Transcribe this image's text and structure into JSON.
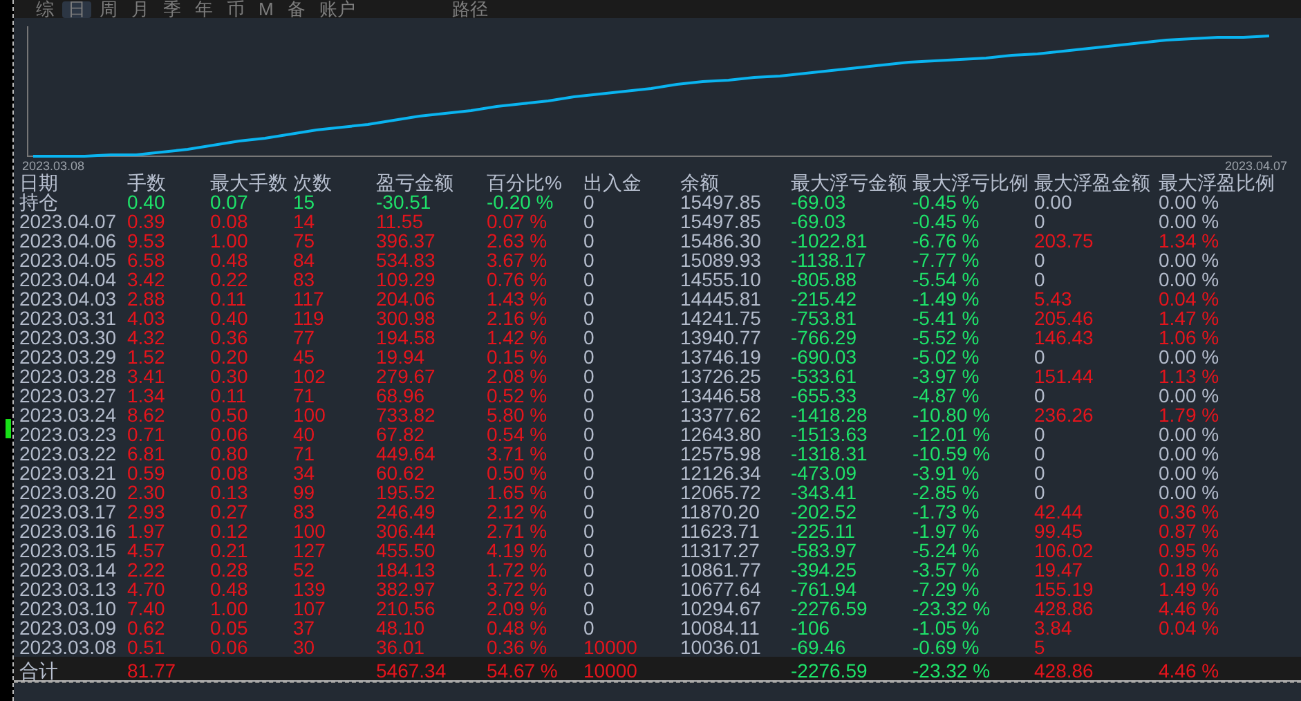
{
  "tabs": [
    {
      "label": "综",
      "selected": false
    },
    {
      "label": "日",
      "selected": true
    },
    {
      "label": "周",
      "selected": false
    },
    {
      "label": "月",
      "selected": false
    },
    {
      "label": "季",
      "selected": false
    },
    {
      "label": "年",
      "selected": false
    },
    {
      "label": "币",
      "selected": false
    },
    {
      "label": "M",
      "selected": false
    },
    {
      "label": "备",
      "selected": false
    },
    {
      "label": "账户",
      "selected": false
    },
    {
      "label": "路径",
      "selected": false
    }
  ],
  "chart": {
    "start_label": "2023.03.08",
    "end_label": "2023.04.07"
  },
  "table": {
    "columns": [
      "日期",
      "手数",
      "最大手数",
      "次数",
      "盈亏金额",
      "百分比%",
      "出入金",
      "余额",
      "最大浮亏金额",
      "最大浮亏比例",
      "最大浮盈金额",
      "最大浮盈比例"
    ],
    "rows": [
      [
        {
          "text": "持仓",
          "color": "#b8c0d0"
        },
        {
          "text": "0.40",
          "color": "#1ee36a"
        },
        {
          "text": "0.07",
          "color": "#1ee36a"
        },
        {
          "text": "15",
          "color": "#1ee36a"
        },
        {
          "text": "-30.51",
          "color": "#1ee36a"
        },
        {
          "text": "-0.20 %",
          "color": "#1ee36a"
        },
        {
          "text": "0",
          "color": "#b4bccc"
        },
        {
          "text": "15497.85",
          "color": "#b4bccc"
        },
        {
          "text": "-69.03",
          "color": "#1ee36a"
        },
        {
          "text": "-0.45 %",
          "color": "#1ee36a"
        },
        {
          "text": "0.00",
          "color": "#b4bccc"
        },
        {
          "text": "0.00 %",
          "color": "#b4bccc"
        }
      ],
      [
        {
          "text": "2023.04.07",
          "color": "#b4bccc"
        },
        {
          "text": "0.39",
          "color": "#e5141c"
        },
        {
          "text": "0.08",
          "color": "#e5141c"
        },
        {
          "text": "14",
          "color": "#e5141c"
        },
        {
          "text": "11.55",
          "color": "#e5141c"
        },
        {
          "text": "0.07 %",
          "color": "#e5141c"
        },
        {
          "text": "0",
          "color": "#b4bccc"
        },
        {
          "text": "15497.85",
          "color": "#b4bccc"
        },
        {
          "text": "-69.03",
          "color": "#1ee36a"
        },
        {
          "text": "-0.45 %",
          "color": "#1ee36a"
        },
        {
          "text": "0",
          "color": "#b4bccc"
        },
        {
          "text": "0.00 %",
          "color": "#b4bccc"
        }
      ],
      [
        {
          "text": "2023.04.06",
          "color": "#b4bccc"
        },
        {
          "text": "9.53",
          "color": "#e5141c"
        },
        {
          "text": "1.00",
          "color": "#e5141c"
        },
        {
          "text": "75",
          "color": "#e5141c"
        },
        {
          "text": "396.37",
          "color": "#e5141c"
        },
        {
          "text": "2.63 %",
          "color": "#e5141c"
        },
        {
          "text": "0",
          "color": "#b4bccc"
        },
        {
          "text": "15486.30",
          "color": "#b4bccc"
        },
        {
          "text": "-1022.81",
          "color": "#1ee36a"
        },
        {
          "text": "-6.76 %",
          "color": "#1ee36a"
        },
        {
          "text": "203.75",
          "color": "#e5141c"
        },
        {
          "text": "1.34 %",
          "color": "#e5141c"
        }
      ],
      [
        {
          "text": "2023.04.05",
          "color": "#b4bccc"
        },
        {
          "text": "6.58",
          "color": "#e5141c"
        },
        {
          "text": "0.48",
          "color": "#e5141c"
        },
        {
          "text": "84",
          "color": "#e5141c"
        },
        {
          "text": "534.83",
          "color": "#e5141c"
        },
        {
          "text": "3.67 %",
          "color": "#e5141c"
        },
        {
          "text": "0",
          "color": "#b4bccc"
        },
        {
          "text": "15089.93",
          "color": "#b4bccc"
        },
        {
          "text": "-1138.17",
          "color": "#1ee36a"
        },
        {
          "text": "-7.77 %",
          "color": "#1ee36a"
        },
        {
          "text": "0",
          "color": "#b4bccc"
        },
        {
          "text": "0.00 %",
          "color": "#b4bccc"
        }
      ],
      [
        {
          "text": "2023.04.04",
          "color": "#b4bccc"
        },
        {
          "text": "3.42",
          "color": "#e5141c"
        },
        {
          "text": "0.22",
          "color": "#e5141c"
        },
        {
          "text": "83",
          "color": "#e5141c"
        },
        {
          "text": "109.29",
          "color": "#e5141c"
        },
        {
          "text": "0.76 %",
          "color": "#e5141c"
        },
        {
          "text": "0",
          "color": "#b4bccc"
        },
        {
          "text": "14555.10",
          "color": "#b4bccc"
        },
        {
          "text": "-805.88",
          "color": "#1ee36a"
        },
        {
          "text": "-5.54 %",
          "color": "#1ee36a"
        },
        {
          "text": "0",
          "color": "#b4bccc"
        },
        {
          "text": "0.00 %",
          "color": "#b4bccc"
        }
      ],
      [
        {
          "text": "2023.04.03",
          "color": "#b4bccc"
        },
        {
          "text": "2.88",
          "color": "#e5141c"
        },
        {
          "text": "0.11",
          "color": "#e5141c"
        },
        {
          "text": "117",
          "color": "#e5141c"
        },
        {
          "text": "204.06",
          "color": "#e5141c"
        },
        {
          "text": "1.43 %",
          "color": "#e5141c"
        },
        {
          "text": "0",
          "color": "#b4bccc"
        },
        {
          "text": "14445.81",
          "color": "#b4bccc"
        },
        {
          "text": "-215.42",
          "color": "#1ee36a"
        },
        {
          "text": "-1.49 %",
          "color": "#1ee36a"
        },
        {
          "text": "5.43",
          "color": "#e5141c"
        },
        {
          "text": "0.04 %",
          "color": "#e5141c"
        }
      ],
      [
        {
          "text": "2023.03.31",
          "color": "#b4bccc"
        },
        {
          "text": "4.03",
          "color": "#e5141c"
        },
        {
          "text": "0.40",
          "color": "#e5141c"
        },
        {
          "text": "119",
          "color": "#e5141c"
        },
        {
          "text": "300.98",
          "color": "#e5141c"
        },
        {
          "text": "2.16 %",
          "color": "#e5141c"
        },
        {
          "text": "0",
          "color": "#b4bccc"
        },
        {
          "text": "14241.75",
          "color": "#b4bccc"
        },
        {
          "text": "-753.81",
          "color": "#1ee36a"
        },
        {
          "text": "-5.41 %",
          "color": "#1ee36a"
        },
        {
          "text": "205.46",
          "color": "#e5141c"
        },
        {
          "text": "1.47 %",
          "color": "#e5141c"
        }
      ],
      [
        {
          "text": "2023.03.30",
          "color": "#b4bccc"
        },
        {
          "text": "4.32",
          "color": "#e5141c"
        },
        {
          "text": "0.36",
          "color": "#e5141c"
        },
        {
          "text": "77",
          "color": "#e5141c"
        },
        {
          "text": "194.58",
          "color": "#e5141c"
        },
        {
          "text": "1.42 %",
          "color": "#e5141c"
        },
        {
          "text": "0",
          "color": "#b4bccc"
        },
        {
          "text": "13940.77",
          "color": "#b4bccc"
        },
        {
          "text": "-766.29",
          "color": "#1ee36a"
        },
        {
          "text": "-5.52 %",
          "color": "#1ee36a"
        },
        {
          "text": "146.43",
          "color": "#e5141c"
        },
        {
          "text": "1.06 %",
          "color": "#e5141c"
        }
      ],
      [
        {
          "text": "2023.03.29",
          "color": "#b4bccc"
        },
        {
          "text": "1.52",
          "color": "#e5141c"
        },
        {
          "text": "0.20",
          "color": "#e5141c"
        },
        {
          "text": "45",
          "color": "#e5141c"
        },
        {
          "text": "19.94",
          "color": "#e5141c"
        },
        {
          "text": "0.15 %",
          "color": "#e5141c"
        },
        {
          "text": "0",
          "color": "#b4bccc"
        },
        {
          "text": "13746.19",
          "color": "#b4bccc"
        },
        {
          "text": "-690.03",
          "color": "#1ee36a"
        },
        {
          "text": "-5.02 %",
          "color": "#1ee36a"
        },
        {
          "text": "0",
          "color": "#b4bccc"
        },
        {
          "text": "0.00 %",
          "color": "#b4bccc"
        }
      ],
      [
        {
          "text": "2023.03.28",
          "color": "#b4bccc"
        },
        {
          "text": "3.41",
          "color": "#e5141c"
        },
        {
          "text": "0.30",
          "color": "#e5141c"
        },
        {
          "text": "102",
          "color": "#e5141c"
        },
        {
          "text": "279.67",
          "color": "#e5141c"
        },
        {
          "text": "2.08 %",
          "color": "#e5141c"
        },
        {
          "text": "0",
          "color": "#b4bccc"
        },
        {
          "text": "13726.25",
          "color": "#b4bccc"
        },
        {
          "text": "-533.61",
          "color": "#1ee36a"
        },
        {
          "text": "-3.97 %",
          "color": "#1ee36a"
        },
        {
          "text": "151.44",
          "color": "#e5141c"
        },
        {
          "text": "1.13 %",
          "color": "#e5141c"
        }
      ],
      [
        {
          "text": "2023.03.27",
          "color": "#b4bccc"
        },
        {
          "text": "1.34",
          "color": "#e5141c"
        },
        {
          "text": "0.11",
          "color": "#e5141c"
        },
        {
          "text": "71",
          "color": "#e5141c"
        },
        {
          "text": "68.96",
          "color": "#e5141c"
        },
        {
          "text": "0.52 %",
          "color": "#e5141c"
        },
        {
          "text": "0",
          "color": "#b4bccc"
        },
        {
          "text": "13446.58",
          "color": "#b4bccc"
        },
        {
          "text": "-655.33",
          "color": "#1ee36a"
        },
        {
          "text": "-4.87 %",
          "color": "#1ee36a"
        },
        {
          "text": "0",
          "color": "#b4bccc"
        },
        {
          "text": "0.00 %",
          "color": "#b4bccc"
        }
      ],
      [
        {
          "text": "2023.03.24",
          "color": "#b4bccc"
        },
        {
          "text": "8.62",
          "color": "#e5141c"
        },
        {
          "text": "0.50",
          "color": "#e5141c"
        },
        {
          "text": "100",
          "color": "#e5141c"
        },
        {
          "text": "733.82",
          "color": "#e5141c"
        },
        {
          "text": "5.80 %",
          "color": "#e5141c"
        },
        {
          "text": "0",
          "color": "#b4bccc"
        },
        {
          "text": "13377.62",
          "color": "#b4bccc"
        },
        {
          "text": "-1418.28",
          "color": "#1ee36a"
        },
        {
          "text": "-10.80 %",
          "color": "#1ee36a"
        },
        {
          "text": "236.26",
          "color": "#e5141c"
        },
        {
          "text": "1.79 %",
          "color": "#e5141c"
        }
      ],
      [
        {
          "text": "2023.03.23",
          "color": "#b4bccc"
        },
        {
          "text": "0.71",
          "color": "#e5141c"
        },
        {
          "text": "0.06",
          "color": "#e5141c"
        },
        {
          "text": "40",
          "color": "#e5141c"
        },
        {
          "text": "67.82",
          "color": "#e5141c"
        },
        {
          "text": "0.54 %",
          "color": "#e5141c"
        },
        {
          "text": "0",
          "color": "#b4bccc"
        },
        {
          "text": "12643.80",
          "color": "#b4bccc"
        },
        {
          "text": "-1513.63",
          "color": "#1ee36a"
        },
        {
          "text": "-12.01 %",
          "color": "#1ee36a"
        },
        {
          "text": "0",
          "color": "#b4bccc"
        },
        {
          "text": "0.00 %",
          "color": "#b4bccc"
        }
      ],
      [
        {
          "text": "2023.03.22",
          "color": "#b4bccc"
        },
        {
          "text": "6.81",
          "color": "#e5141c"
        },
        {
          "text": "0.80",
          "color": "#e5141c"
        },
        {
          "text": "71",
          "color": "#e5141c"
        },
        {
          "text": "449.64",
          "color": "#e5141c"
        },
        {
          "text": "3.71 %",
          "color": "#e5141c"
        },
        {
          "text": "0",
          "color": "#b4bccc"
        },
        {
          "text": "12575.98",
          "color": "#b4bccc"
        },
        {
          "text": "-1318.31",
          "color": "#1ee36a"
        },
        {
          "text": "-10.59 %",
          "color": "#1ee36a"
        },
        {
          "text": "0",
          "color": "#b4bccc"
        },
        {
          "text": "0.00 %",
          "color": "#b4bccc"
        }
      ],
      [
        {
          "text": "2023.03.21",
          "color": "#b4bccc"
        },
        {
          "text": "0.59",
          "color": "#e5141c"
        },
        {
          "text": "0.08",
          "color": "#e5141c"
        },
        {
          "text": "34",
          "color": "#e5141c"
        },
        {
          "text": "60.62",
          "color": "#e5141c"
        },
        {
          "text": "0.50 %",
          "color": "#e5141c"
        },
        {
          "text": "0",
          "color": "#b4bccc"
        },
        {
          "text": "12126.34",
          "color": "#b4bccc"
        },
        {
          "text": "-473.09",
          "color": "#1ee36a"
        },
        {
          "text": "-3.91 %",
          "color": "#1ee36a"
        },
        {
          "text": "0",
          "color": "#b4bccc"
        },
        {
          "text": "0.00 %",
          "color": "#b4bccc"
        }
      ],
      [
        {
          "text": "2023.03.20",
          "color": "#b4bccc"
        },
        {
          "text": "2.30",
          "color": "#e5141c"
        },
        {
          "text": "0.13",
          "color": "#e5141c"
        },
        {
          "text": "99",
          "color": "#e5141c"
        },
        {
          "text": "195.52",
          "color": "#e5141c"
        },
        {
          "text": "1.65 %",
          "color": "#e5141c"
        },
        {
          "text": "0",
          "color": "#b4bccc"
        },
        {
          "text": "12065.72",
          "color": "#b4bccc"
        },
        {
          "text": "-343.41",
          "color": "#1ee36a"
        },
        {
          "text": "-2.85 %",
          "color": "#1ee36a"
        },
        {
          "text": "0",
          "color": "#b4bccc"
        },
        {
          "text": "0.00 %",
          "color": "#b4bccc"
        }
      ],
      [
        {
          "text": "2023.03.17",
          "color": "#b4bccc"
        },
        {
          "text": "2.93",
          "color": "#e5141c"
        },
        {
          "text": "0.27",
          "color": "#e5141c"
        },
        {
          "text": "83",
          "color": "#e5141c"
        },
        {
          "text": "246.49",
          "color": "#e5141c"
        },
        {
          "text": "2.12 %",
          "color": "#e5141c"
        },
        {
          "text": "0",
          "color": "#b4bccc"
        },
        {
          "text": "11870.20",
          "color": "#b4bccc"
        },
        {
          "text": "-202.52",
          "color": "#1ee36a"
        },
        {
          "text": "-1.73 %",
          "color": "#1ee36a"
        },
        {
          "text": "42.44",
          "color": "#e5141c"
        },
        {
          "text": "0.36 %",
          "color": "#e5141c"
        }
      ],
      [
        {
          "text": "2023.03.16",
          "color": "#b4bccc"
        },
        {
          "text": "1.97",
          "color": "#e5141c"
        },
        {
          "text": "0.12",
          "color": "#e5141c"
        },
        {
          "text": "100",
          "color": "#e5141c"
        },
        {
          "text": "306.44",
          "color": "#e5141c"
        },
        {
          "text": "2.71 %",
          "color": "#e5141c"
        },
        {
          "text": "0",
          "color": "#b4bccc"
        },
        {
          "text": "11623.71",
          "color": "#b4bccc"
        },
        {
          "text": "-225.11",
          "color": "#1ee36a"
        },
        {
          "text": "-1.97 %",
          "color": "#1ee36a"
        },
        {
          "text": "99.45",
          "color": "#e5141c"
        },
        {
          "text": "0.87 %",
          "color": "#e5141c"
        }
      ],
      [
        {
          "text": "2023.03.15",
          "color": "#b4bccc"
        },
        {
          "text": "4.57",
          "color": "#e5141c"
        },
        {
          "text": "0.21",
          "color": "#e5141c"
        },
        {
          "text": "127",
          "color": "#e5141c"
        },
        {
          "text": "455.50",
          "color": "#e5141c"
        },
        {
          "text": "4.19 %",
          "color": "#e5141c"
        },
        {
          "text": "0",
          "color": "#b4bccc"
        },
        {
          "text": "11317.27",
          "color": "#b4bccc"
        },
        {
          "text": "-583.97",
          "color": "#1ee36a"
        },
        {
          "text": "-5.24 %",
          "color": "#1ee36a"
        },
        {
          "text": "106.02",
          "color": "#e5141c"
        },
        {
          "text": "0.95 %",
          "color": "#e5141c"
        }
      ],
      [
        {
          "text": "2023.03.14",
          "color": "#b4bccc"
        },
        {
          "text": "2.22",
          "color": "#e5141c"
        },
        {
          "text": "0.28",
          "color": "#e5141c"
        },
        {
          "text": "52",
          "color": "#e5141c"
        },
        {
          "text": "184.13",
          "color": "#e5141c"
        },
        {
          "text": "1.72 %",
          "color": "#e5141c"
        },
        {
          "text": "0",
          "color": "#b4bccc"
        },
        {
          "text": "10861.77",
          "color": "#b4bccc"
        },
        {
          "text": "-394.25",
          "color": "#1ee36a"
        },
        {
          "text": "-3.57 %",
          "color": "#1ee36a"
        },
        {
          "text": "19.47",
          "color": "#e5141c"
        },
        {
          "text": "0.18 %",
          "color": "#e5141c"
        }
      ],
      [
        {
          "text": "2023.03.13",
          "color": "#b4bccc"
        },
        {
          "text": "4.70",
          "color": "#e5141c"
        },
        {
          "text": "0.48",
          "color": "#e5141c"
        },
        {
          "text": "139",
          "color": "#e5141c"
        },
        {
          "text": "382.97",
          "color": "#e5141c"
        },
        {
          "text": "3.72 %",
          "color": "#e5141c"
        },
        {
          "text": "0",
          "color": "#b4bccc"
        },
        {
          "text": "10677.64",
          "color": "#b4bccc"
        },
        {
          "text": "-761.94",
          "color": "#1ee36a"
        },
        {
          "text": "-7.29 %",
          "color": "#1ee36a"
        },
        {
          "text": "155.19",
          "color": "#e5141c"
        },
        {
          "text": "1.49 %",
          "color": "#e5141c"
        }
      ],
      [
        {
          "text": "2023.03.10",
          "color": "#b4bccc"
        },
        {
          "text": "7.40",
          "color": "#e5141c"
        },
        {
          "text": "1.00",
          "color": "#e5141c"
        },
        {
          "text": "107",
          "color": "#e5141c"
        },
        {
          "text": "210.56",
          "color": "#e5141c"
        },
        {
          "text": "2.09 %",
          "color": "#e5141c"
        },
        {
          "text": "0",
          "color": "#b4bccc"
        },
        {
          "text": "10294.67",
          "color": "#b4bccc"
        },
        {
          "text": "-2276.59",
          "color": "#1ee36a"
        },
        {
          "text": "-23.32 %",
          "color": "#1ee36a"
        },
        {
          "text": "428.86",
          "color": "#e5141c"
        },
        {
          "text": "4.46 %",
          "color": "#e5141c"
        }
      ],
      [
        {
          "text": "2023.03.09",
          "color": "#b4bccc"
        },
        {
          "text": "0.62",
          "color": "#e5141c"
        },
        {
          "text": "0.05",
          "color": "#e5141c"
        },
        {
          "text": "37",
          "color": "#e5141c"
        },
        {
          "text": "48.10",
          "color": "#e5141c"
        },
        {
          "text": "0.48 %",
          "color": "#e5141c"
        },
        {
          "text": "0",
          "color": "#b4bccc"
        },
        {
          "text": "10084.11",
          "color": "#b4bccc"
        },
        {
          "text": "-106",
          "color": "#1ee36a"
        },
        {
          "text": "-1.05 %",
          "color": "#1ee36a"
        },
        {
          "text": "3.84",
          "color": "#e5141c"
        },
        {
          "text": "0.04 %",
          "color": "#e5141c"
        }
      ],
      [
        {
          "text": "2023.03.08",
          "color": "#b4bccc"
        },
        {
          "text": "0.51",
          "color": "#e5141c"
        },
        {
          "text": "0.06",
          "color": "#e5141c"
        },
        {
          "text": "30",
          "color": "#e5141c"
        },
        {
          "text": "36.01",
          "color": "#e5141c"
        },
        {
          "text": "0.36 %",
          "color": "#e5141c"
        },
        {
          "text": "10000",
          "color": "#e5141c"
        },
        {
          "text": "10036.01",
          "color": "#b4bccc"
        },
        {
          "text": "-69.46",
          "color": "#1ee36a"
        },
        {
          "text": "-0.69 %",
          "color": "#1ee36a"
        },
        {
          "text": "5",
          "color": "#e5141c"
        },
        null
      ]
    ],
    "total": {
      "label": {
        "text": "合计",
        "color": "#b8c0d0"
      },
      "lots": {
        "text": "81.77",
        "color": "#e5141c"
      },
      "profit": {
        "text": "5467.34",
        "color": "#e5141c"
      },
      "percent": {
        "text": "54.67 %",
        "color": "#e5141c"
      },
      "deposit": {
        "text": "10000",
        "color": "#e5141c"
      },
      "max_loss": {
        "text": "-2276.59",
        "color": "#1ee36a"
      },
      "max_loss_pct": {
        "text": "-23.32 %",
        "color": "#1ee36a"
      },
      "max_gain": {
        "text": "428.86",
        "color": "#e5141c"
      },
      "max_gain_pct": {
        "text": "4.46 %",
        "color": "#e5141c"
      }
    }
  }
}
